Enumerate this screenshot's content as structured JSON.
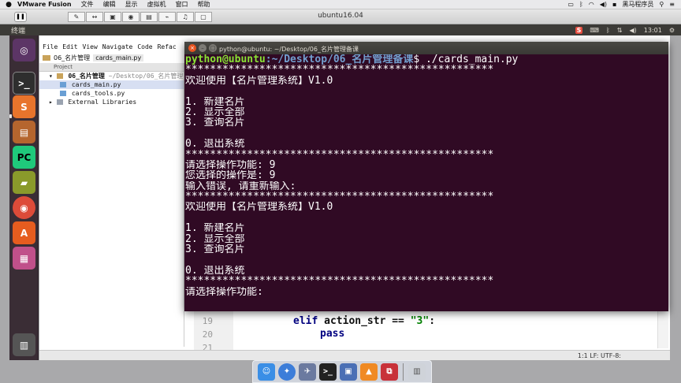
{
  "mac_menubar": {
    "app_name": "VMware Fusion",
    "menus": [
      "文件",
      "编辑",
      "显示",
      "虚拟机",
      "窗口",
      "帮助"
    ],
    "user_name": "黑马程序员"
  },
  "vmware": {
    "window_title": "ubuntu16.04"
  },
  "ubuntu_panel": {
    "title": "终端",
    "clock": "13:01",
    "sogou": "S"
  },
  "ide": {
    "menus": [
      "File",
      "Edit",
      "View",
      "Navigate",
      "Code",
      "Refac"
    ],
    "breadcrumb_folder": "06_名片管理",
    "breadcrumb_file": "cards_main.py",
    "project_label": "Project",
    "tree": {
      "root": "06_名片管理",
      "root_path": "~/Desktop/06_名片管理",
      "file1": "cards_main.py",
      "file2": "cards_tools.py",
      "libs": "External Libraries"
    },
    "code_lines": [
      {
        "num": "19",
        "kw": "elif",
        "rest": " action_str == ",
        "str": "\"3\"",
        "tail": ":"
      },
      {
        "num": "20",
        "text": "pass"
      },
      {
        "num": "21",
        "text": ""
      }
    ],
    "status": "1:1  LF:  UTF-8:"
  },
  "terminal": {
    "title": "python@ubuntu: ~/Desktop/06_名片管理备课",
    "prompt_user": "python@ubuntu",
    "prompt_path": ":~/Desktop/06_名片管理备课",
    "command": "$ ./cards_main.py",
    "stars": "**************************************************",
    "welcome": "欢迎使用【名片管理系统】V1.0",
    "menu1": "1. 新建名片",
    "menu2": "2. 显示全部",
    "menu3": "3. 查询名片",
    "menu0": "0. 退出系统",
    "ask": "请选择操作功能: 9",
    "chosen": "您选择的操作是: 9",
    "error": "输入错误, 请重新输入:",
    "ask_again": "请选择操作功能:"
  },
  "colors": {
    "terminal_bg": "#300a24",
    "prompt_user": "#8ae234",
    "prompt_path": "#729fcf",
    "ubuntu_panel": "#3c3b37",
    "launcher_bg": "#3a2d35"
  }
}
